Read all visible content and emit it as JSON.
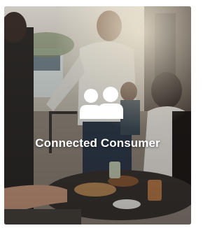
{
  "card": {
    "title": "Connected Consumer",
    "icon": "users-icon",
    "icon_color": "#ffffff"
  }
}
